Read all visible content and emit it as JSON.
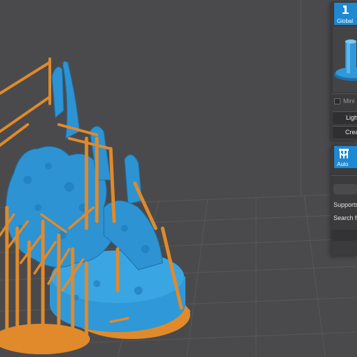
{
  "viewport": {
    "name": "3D print preview",
    "colors": {
      "background": "#4a4a4c",
      "grid": "#5a5a5d",
      "model": "#2f98d8",
      "supports": "#e08a2c"
    }
  },
  "global_panel": {
    "mode_label": "Global",
    "mode_icon": "one-icon",
    "mini_label": "Mini",
    "light_label": "Ligh",
    "create_label": "Crea"
  },
  "auto_panel": {
    "mode_label": "Auto",
    "mode_icon": "auto-supports-icon",
    "supports_label": "Supports",
    "search_label": "Search f"
  }
}
